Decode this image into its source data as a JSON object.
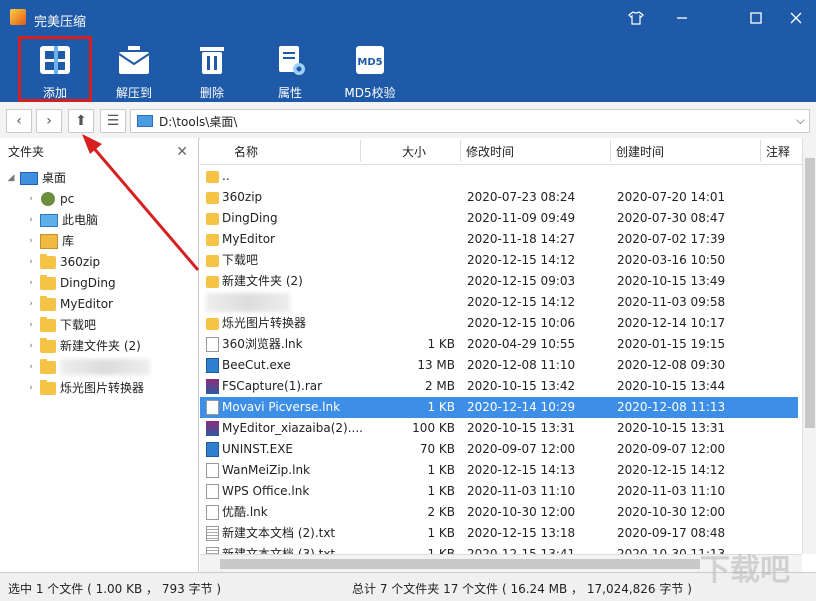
{
  "app": {
    "title": "完美压缩",
    "window_controls": [
      "shirt-icon",
      "minimize-icon",
      "maximize-icon",
      "close-icon"
    ]
  },
  "toolbar": {
    "buttons": [
      {
        "label": "添加",
        "icon": "add-archive-icon"
      },
      {
        "label": "解压到",
        "icon": "extract-icon"
      },
      {
        "label": "删除",
        "icon": "delete-icon"
      },
      {
        "label": "属性",
        "icon": "properties-icon"
      },
      {
        "label": "MD5校验",
        "icon": "md5-icon"
      }
    ],
    "md5_badge": "MD5",
    "highlight_color": "#d62020"
  },
  "address": {
    "path": "D:\\tools\\桌面\\"
  },
  "left_panel": {
    "title": "文件夹",
    "tree": [
      {
        "label": "桌面",
        "icon": "desktop-icon"
      },
      {
        "label": "pc",
        "icon": "user-icon"
      },
      {
        "label": "此电脑",
        "icon": "computer-icon"
      },
      {
        "label": "库",
        "icon": "library-icon"
      },
      {
        "label": "360zip",
        "icon": "folder-icon"
      },
      {
        "label": "DingDing",
        "icon": "folder-icon"
      },
      {
        "label": "MyEditor",
        "icon": "folder-icon"
      },
      {
        "label": "下载吧",
        "icon": "folder-icon"
      },
      {
        "label": "新建文件夹 (2)",
        "icon": "folder-icon"
      },
      {
        "label": "",
        "icon": "folder-icon"
      },
      {
        "label": "烁光图片转换器",
        "icon": "folder-icon"
      }
    ]
  },
  "file_list": {
    "columns": [
      "名称",
      "大小",
      "修改时间",
      "创建时间",
      "注释"
    ],
    "rows": [
      {
        "name": "..",
        "size": "",
        "modified": "",
        "created": "",
        "type": "folder"
      },
      {
        "name": "360zip",
        "size": "",
        "modified": "2020-07-23 08:24",
        "created": "2020-07-20 14:01",
        "type": "folder"
      },
      {
        "name": "DingDing",
        "size": "",
        "modified": "2020-11-09 09:49",
        "created": "2020-07-30 08:47",
        "type": "folder"
      },
      {
        "name": "MyEditor",
        "size": "",
        "modified": "2020-11-18 14:27",
        "created": "2020-07-02 17:39",
        "type": "folder"
      },
      {
        "name": "下载吧",
        "size": "",
        "modified": "2020-12-15 14:12",
        "created": "2020-03-16 10:50",
        "type": "folder"
      },
      {
        "name": "新建文件夹 (2)",
        "size": "",
        "modified": "2020-12-15 09:03",
        "created": "2020-10-15 13:49",
        "type": "folder"
      },
      {
        "name": "",
        "size": "",
        "modified": "2020-12-15 14:12",
        "created": "2020-11-03 09:58",
        "type": "blurred"
      },
      {
        "name": "烁光图片转换器",
        "size": "",
        "modified": "2020-12-15 10:06",
        "created": "2020-12-14 10:17",
        "type": "folder"
      },
      {
        "name": "360浏览器.lnk",
        "size": "1 KB",
        "modified": "2020-04-29 10:55",
        "created": "2020-01-15 19:15",
        "type": "file"
      },
      {
        "name": "BeeCut.exe",
        "size": "13 MB",
        "modified": "2020-12-08 11:10",
        "created": "2020-12-08 09:30",
        "type": "exe"
      },
      {
        "name": "FSCapture(1).rar",
        "size": "2 MB",
        "modified": "2020-10-15 13:42",
        "created": "2020-10-15 13:44",
        "type": "rar"
      },
      {
        "name": "Movavi Picverse.lnk",
        "size": "1 KB",
        "modified": "2020-12-14 10:29",
        "created": "2020-12-08 11:13",
        "type": "file",
        "selected": true
      },
      {
        "name": "MyEditor_xiazaiba(2)....",
        "size": "100 KB",
        "modified": "2020-10-15 13:31",
        "created": "2020-10-15 13:31",
        "type": "rar"
      },
      {
        "name": "UNINST.EXE",
        "size": "70 KB",
        "modified": "2020-09-07 12:00",
        "created": "2020-09-07 12:00",
        "type": "exe"
      },
      {
        "name": "WanMeiZip.lnk",
        "size": "1 KB",
        "modified": "2020-12-15 14:13",
        "created": "2020-12-15 14:12",
        "type": "file"
      },
      {
        "name": "WPS Office.lnk",
        "size": "1 KB",
        "modified": "2020-11-03 11:10",
        "created": "2020-11-03 11:10",
        "type": "file"
      },
      {
        "name": "优酷.lnk",
        "size": "2 KB",
        "modified": "2020-10-30 12:00",
        "created": "2020-10-30 12:00",
        "type": "file"
      },
      {
        "name": "新建文本文档 (2).txt",
        "size": "1 KB",
        "modified": "2020-12-15 13:18",
        "created": "2020-09-17 08:48",
        "type": "txt"
      },
      {
        "name": "新建文本文档 (3).txt",
        "size": "1 KB",
        "modified": "2020-12-15 13:41",
        "created": "2020-10-30 11:13",
        "type": "txt"
      }
    ]
  },
  "status": {
    "left": "选中 1 个文件 ( 1.00 KB ， 793 字节 )",
    "right": "总计 7 个文件夹 17 个文件 ( 16.24 MB ， 17,024,826 字节 )"
  },
  "colors": {
    "titlebar": "#1e5aa8",
    "selection": "#3d8ee6",
    "annotation_arrow": "#d62020"
  }
}
